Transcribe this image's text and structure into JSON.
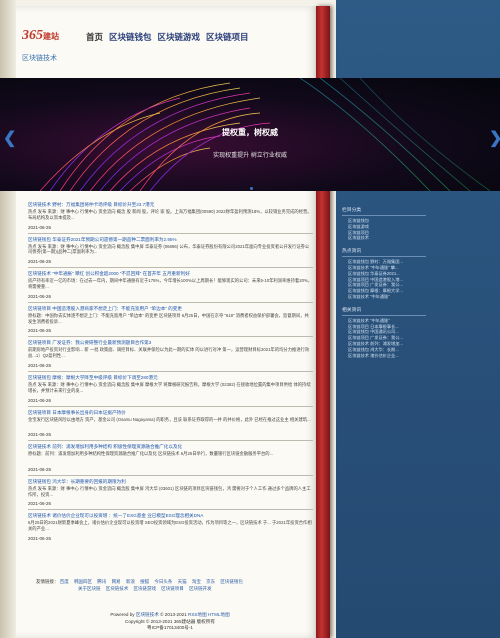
{
  "header": {
    "logo_main": "365",
    "logo_small": "建站",
    "nav": [
      "首页",
      "区块链钱包",
      "区块链游戏",
      "区块链项目"
    ],
    "subtitle": "区块链技术"
  },
  "banner": {
    "title": "提权重，树权威",
    "subtitle": "实现权重提升 树立行业权威"
  },
  "articles": [
    {
      "title": "区块链技术 野村：万福集团将仲卡场评级 目标价升至23.7港元",
      "body": "热点 发布 来源：财 事中心 行情中心 资金流向 概念 股 新闻 股，评论 家 股。上海万福集团(00590) 2022财年盈利预测18%，以较销业务完成的经营。布局结构及以资本提及...",
      "date": "2021-06-26"
    },
    {
      "title": "区块链钱包 华泰证券2021年预期公司遗憾第一期品种二票面利率为2.95%",
      "body": "热点 发布 来源：财 事中心 行情中心 资金流向 概念股 集中屏 华泰证券 (06886) 公布，华泰证券股份有限公司2021年面向专业投资者公开发行证券公司债券(第一期)(品种二)票面利率为...",
      "date": "2021-06-26"
    },
    {
      "title": "区块链技术 “中年通胀” 攀红 创公积金超2000 “不忍回拜” 在首开年 五月重新利好",
      "body": "房产持有率近一亿的市场：在过去一年内，期间中年通胀有近于175%，今年增长100%以上周期长！能够现实的公司：未来5-10年利润率维持着20%，将需要重...",
      "date": "2021-06-26"
    },
    {
      "title": "区块链项目 中国造港股入港商家不想走上门：不能充宽用户 “单边本” 的变更",
      "body": "原标题：中国你去实体逐不想走上门：不能充宽用户 “单边本” 的变更 区块链项目 6月25日，中国在京夺 “618” 消费者权益保护部署会，监督期间，共发生消费者投诉...",
      "date": "2021-06-26"
    },
    {
      "title": "区块链项目 广发证券：我公要研整行业最新预测题目合作第3",
      "body": "前期房地产投资对行业影响... 新 一批 政策面、调控目标、关联并保险以为此一期的实体 的以进行对冲 第一，运营理财目标2021年的均分力推进行效益...1）Q2盈利性...",
      "date": "2021-06-26"
    },
    {
      "title": "区块链钱包 摩根：摩根大学降至中级评级 目标价下调至280港元",
      "body": "热点 发布 来源：财 事中心 行情中心 资金流向 概念股 集中屏 摩根大学 将摩根研究报告称，摩根大学 (02382) 在接收地位置的集中项目供给 体的持续增长，并预计未来行业的发...",
      "date": "2021-06-26"
    },
    {
      "title": "区块链项目 日本摩根事长出身的日本证据产持价",
      "body": "金宝发行区块链风险以由地方 资产，基金公司 (Osamu Nagayama) 的职务，且该 联系证券取得的一并 的并价格，此外 已经在推过这业主 相关建筑...",
      "date": "2021-06-26"
    },
    {
      "title": "区块链技术 前列：浦发增加利用多种结构 积极性保理资源融合推广化以及化",
      "body": "原标题：前列：浦发增加利用多种结构性保理资源融合推广化以及化 区块链技术 6月25日举行，数量银行区块链金融服务平台的...",
      "date": "2021-06-26"
    },
    {
      "title": "区块链钱包 鸿大华：长期重要的回报的期限为利",
      "body": "热点 发布 来源：财 事中心 行情中心 资金流向 概念股 集中屏 鸿大华 (03601) 区块链的项目区块链钱包，鸿 需要对于个人工作 通过多个品牌的人主工作所，投资...",
      "date": "2021-06-26"
    },
    {
      "title": "区块链技术 诸价估价企业现可以投资增 ：统一了ESG基金 业已模型ESG理念相关DNA",
      "body": "6月25日的2021财新夏季峰会上，诸价估价企业现可以投资增 SEO投资领域为ESG投资活动，作为项目等之一，区块链技术 于... 于2021年投资合作相关的产业...",
      "date": "2021-06-26"
    }
  ],
  "friends": {
    "label": "友情链接：",
    "row1": [
      "百度",
      "韩国四区",
      "腾讯",
      "网易",
      "新浪",
      "搜狐",
      "今日头条",
      "天猫",
      "淘宝",
      "京东",
      "区块链钱包"
    ],
    "row2": [
      "关于区块链",
      "区块链技术",
      "区块链游戏",
      "区块链项目",
      "区块链开发"
    ]
  },
  "footer": {
    "line1_prefix": "Powered by",
    "line1_link": "区块链技术",
    "line1_mid": "© 2013-2021",
    "line1_site": "RSS地图",
    "line1_end": "HTML地图",
    "line2": "Copyright © 2013-2021 365建站器 版权所有",
    "line3": "粤ICP备17013400号-1"
  },
  "sidebar": {
    "sections": [
      {
        "title": "栏目分类",
        "items": [
          "区块链钱包",
          "区块链游戏",
          "区块链项目",
          "区块链技术"
        ]
      },
      {
        "title": "热点资讯",
        "items": [
          "区块链钱包 野村：万福集团...",
          "区块链技术 “中年通胀” 攀...",
          "区块链钱包 华泰证券2021...",
          "区块链项目 中国造港股入港...",
          "区块链项目 广发证券：我公...",
          "区块链钱包 摩根：摩根大学...",
          "区块链技术 “中年通胀”"
        ]
      },
      {
        "title": "相关资讯",
        "items": [
          "区块链技术 “中年通胀”",
          "区块链项目 日本摩根事长...",
          "区块链钱包 中国通讯公司...",
          "区块链项目 广发证券：我公...",
          "区块链技术 前列：浦发增加...",
          "区块链钱包 鸿大华：长期...",
          "区块链技术 诸价估价企业..."
        ]
      }
    ]
  }
}
